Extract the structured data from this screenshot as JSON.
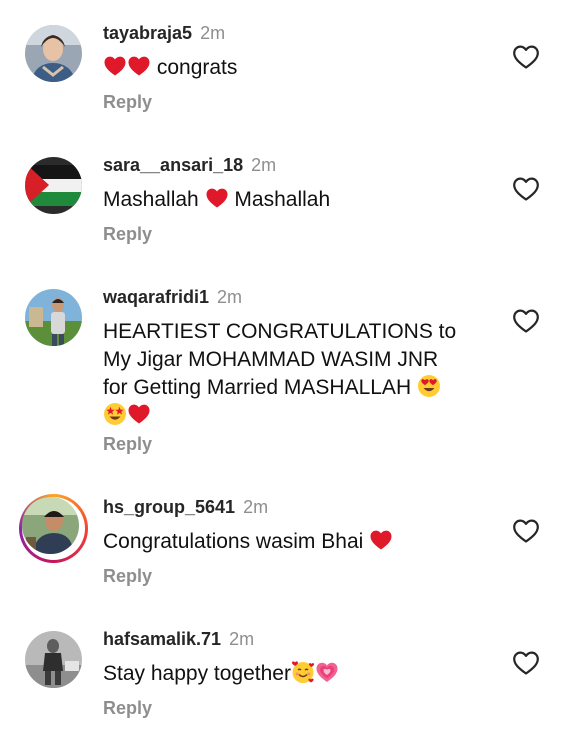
{
  "comments": [
    {
      "username": "tayabraja5",
      "time": "2m",
      "text_after": "congrats",
      "emojis": [
        "red-heart",
        "red-heart"
      ],
      "reply_label": "Reply"
    },
    {
      "username": "sara__ansari_18",
      "time": "2m",
      "text_before": "Mashallah",
      "text_after": "Mashallah",
      "emojis": [
        "red-heart"
      ],
      "reply_label": "Reply"
    },
    {
      "username": "waqarafridi1",
      "time": "2m",
      "text_line1": "HEARTIEST CONGRATULATIONS to",
      "text_line2": "My Jigar MOHAMMAD WASIM JNR",
      "text_line3": "for Getting Married MASHALLAH",
      "emojis": [
        "heart-eyes",
        "star-struck",
        "red-heart"
      ],
      "reply_label": "Reply"
    },
    {
      "username": "hs_group_5641",
      "time": "2m",
      "text_before": "Congratulations wasim Bhai",
      "emojis": [
        "red-heart"
      ],
      "reply_label": "Reply"
    },
    {
      "username": "hafsamalik.71",
      "time": "2m",
      "text_before": "Stay happy together",
      "emojis": [
        "smiling-face-with-hearts",
        "growing-heart"
      ],
      "reply_label": "Reply"
    }
  ],
  "colors": {
    "secondary_text": "#8e8e8e",
    "heart": "#e0192a",
    "story_ring": "#d62976"
  }
}
